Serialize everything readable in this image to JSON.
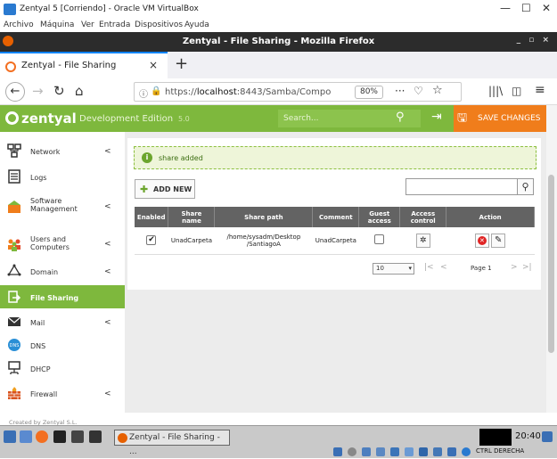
{
  "vbox": {
    "title": "Zentyal 5 [Corriendo] - Oracle VM VirtualBox",
    "menu": [
      "Archivo",
      "Máquina",
      "Ver",
      "Entrada",
      "Dispositivos",
      "Ayuda"
    ],
    "win_min": "—",
    "win_max": "☐",
    "win_close": "✕"
  },
  "firefox": {
    "window_title": "Zentyal - File Sharing - Mozilla Firefox",
    "window_controls": "_ ▫ ×",
    "tab_label": "Zentyal - File Sharing",
    "tab_close": "×",
    "new_tab": "+",
    "url_prefix": "https://",
    "url_host": "localhost",
    "url_path": ":8443/Samba/Compo",
    "zoom": "80%",
    "more": "···"
  },
  "zentyal": {
    "logo": "zentyal",
    "edition": "Development Edition",
    "version": "5.0",
    "search_placeholder": "Search...",
    "save_changes": "SAVE CHANGES"
  },
  "sidebar": {
    "items": [
      {
        "label": "Network",
        "chevron": "<"
      },
      {
        "label": "Logs",
        "chevron": ""
      },
      {
        "label": "Software\nManagement",
        "chevron": "<"
      },
      {
        "label": "Users and\nComputers",
        "chevron": "<"
      },
      {
        "label": "Domain",
        "chevron": "<"
      },
      {
        "label": "File Sharing",
        "chevron": ""
      },
      {
        "label": "Mail",
        "chevron": "<"
      },
      {
        "label": "DNS",
        "chevron": ""
      },
      {
        "label": "DHCP",
        "chevron": ""
      },
      {
        "label": "Firewall",
        "chevron": "<"
      }
    ],
    "active": "File Sharing",
    "footer": "Created by Zentyal S.L."
  },
  "content": {
    "notice": "share added",
    "add_new": "ADD NEW",
    "columns": [
      "Enabled",
      "Share name",
      "Share path",
      "Comment",
      "Guest access",
      "Access control",
      "Action"
    ],
    "rows": [
      {
        "enabled": true,
        "share_name": "UnadCarpeta",
        "share_path": "/home/sysadm/Desktop\n/SantiagoA",
        "comment": "UnadCarpeta",
        "guest_access": false
      }
    ],
    "page_size": "10",
    "page_label": "Page 1"
  },
  "taskbar": {
    "firefox_task": "Zentyal - File Sharing - ...",
    "clock": "20:40",
    "host_key": "CTRL DERECHA"
  }
}
